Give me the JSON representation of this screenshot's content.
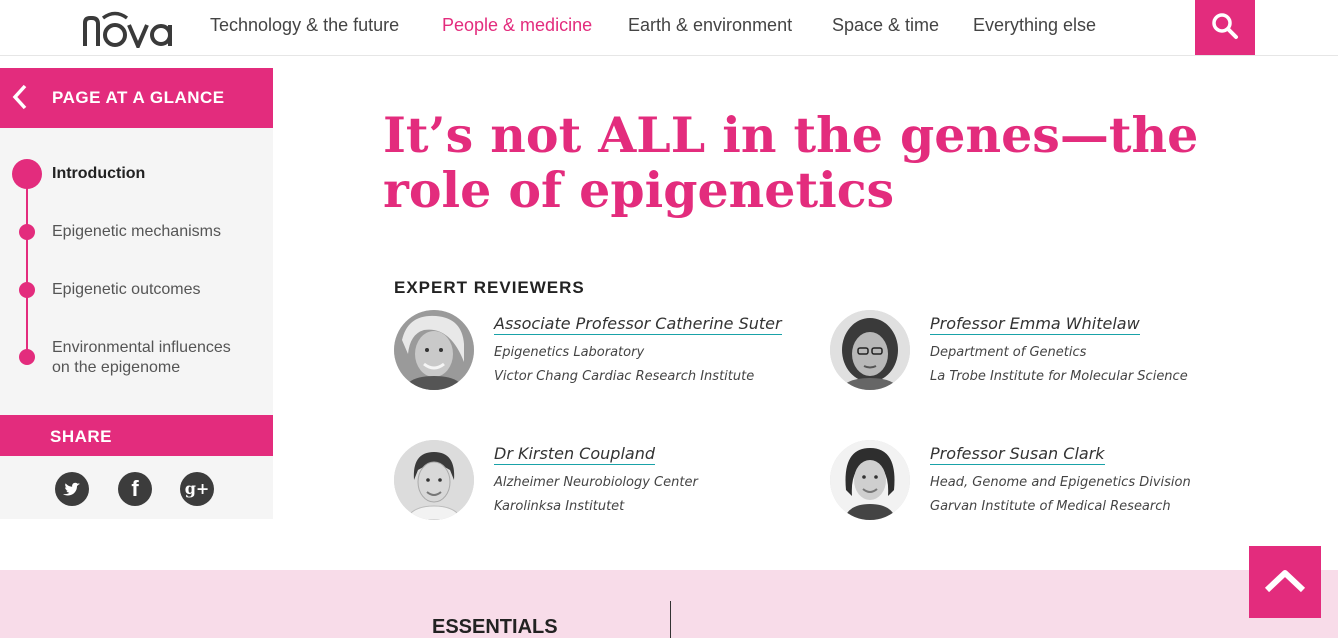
{
  "brand": {
    "logo_text": "nova",
    "accent_color": "#e32c7d",
    "link_underline_color": "#19a2a8"
  },
  "nav": {
    "items": [
      {
        "label": "Technology & the future"
      },
      {
        "label": "People & medicine"
      },
      {
        "label": "Earth & environment"
      },
      {
        "label": "Space & time"
      },
      {
        "label": "Everything else"
      }
    ],
    "active_item": "People & medicine",
    "search_icon": "search-icon"
  },
  "sidebar": {
    "glance_label": "PAGE AT A GLANCE",
    "back_icon": "chevron-left-icon",
    "toc": [
      {
        "label": "Introduction"
      },
      {
        "label": "Epigenetic mechanisms"
      },
      {
        "label": "Epigenetic outcomes"
      },
      {
        "label": "Environmental influences on the epigenome"
      }
    ],
    "current_item": "Introduction",
    "share_label": "SHARE",
    "social_icons": [
      "twitter-icon",
      "facebook-icon",
      "google-plus-icon"
    ]
  },
  "article": {
    "title": "It’s not ALL in the genes—the role of epigenetics",
    "reviewers_heading": "EXPERT REVIEWERS",
    "reviewers": [
      {
        "name": "Associate Professor Catherine Suter",
        "line1": "Epigenetics Laboratory",
        "line2": "Victor Chang Cardiac Research Institute"
      },
      {
        "name": "Professor Emma Whitelaw",
        "line1": "Department of Genetics",
        "line2": "La Trobe Institute for Molecular Science"
      },
      {
        "name": "Dr Kirsten Coupland",
        "line1": "Alzheimer Neurobiology Center",
        "line2": "Karolinksa Institutet"
      },
      {
        "name": "Professor Susan Clark",
        "line1": "Head, Genome and Epigenetics Division",
        "line2": "Garvan Institute of Medical Research"
      }
    ]
  },
  "footer": {
    "essentials_label": "ESSENTIALS",
    "back_to_top_icon": "chevron-up-icon"
  }
}
